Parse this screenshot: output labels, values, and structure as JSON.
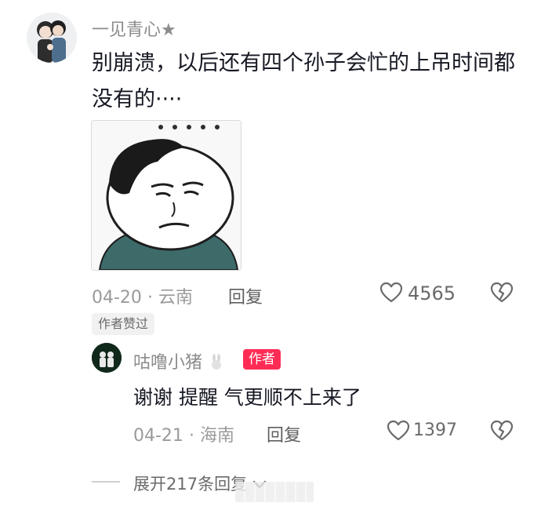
{
  "comment": {
    "username": "一见青心★",
    "text": "别崩溃，以后还有四个孙子会忙的上吊时间都没有的····",
    "date": "04-20",
    "location": "云南",
    "reply_label": "回复",
    "like_count": "4565",
    "liked_by_author_tag": "作者赞过"
  },
  "reply": {
    "username": "咕噜小猪",
    "author_tag": "作者",
    "text": "谢谢 提醒 气更顺不上来了",
    "date": "04-21",
    "location": "海南",
    "reply_label": "回复",
    "like_count": "1397"
  },
  "expand_replies": "展开217条回复",
  "separator": "·",
  "colors": {
    "author_tag_bg": "#fe2c55",
    "text_primary": "#161823",
    "text_secondary": "#9a9a9a"
  }
}
